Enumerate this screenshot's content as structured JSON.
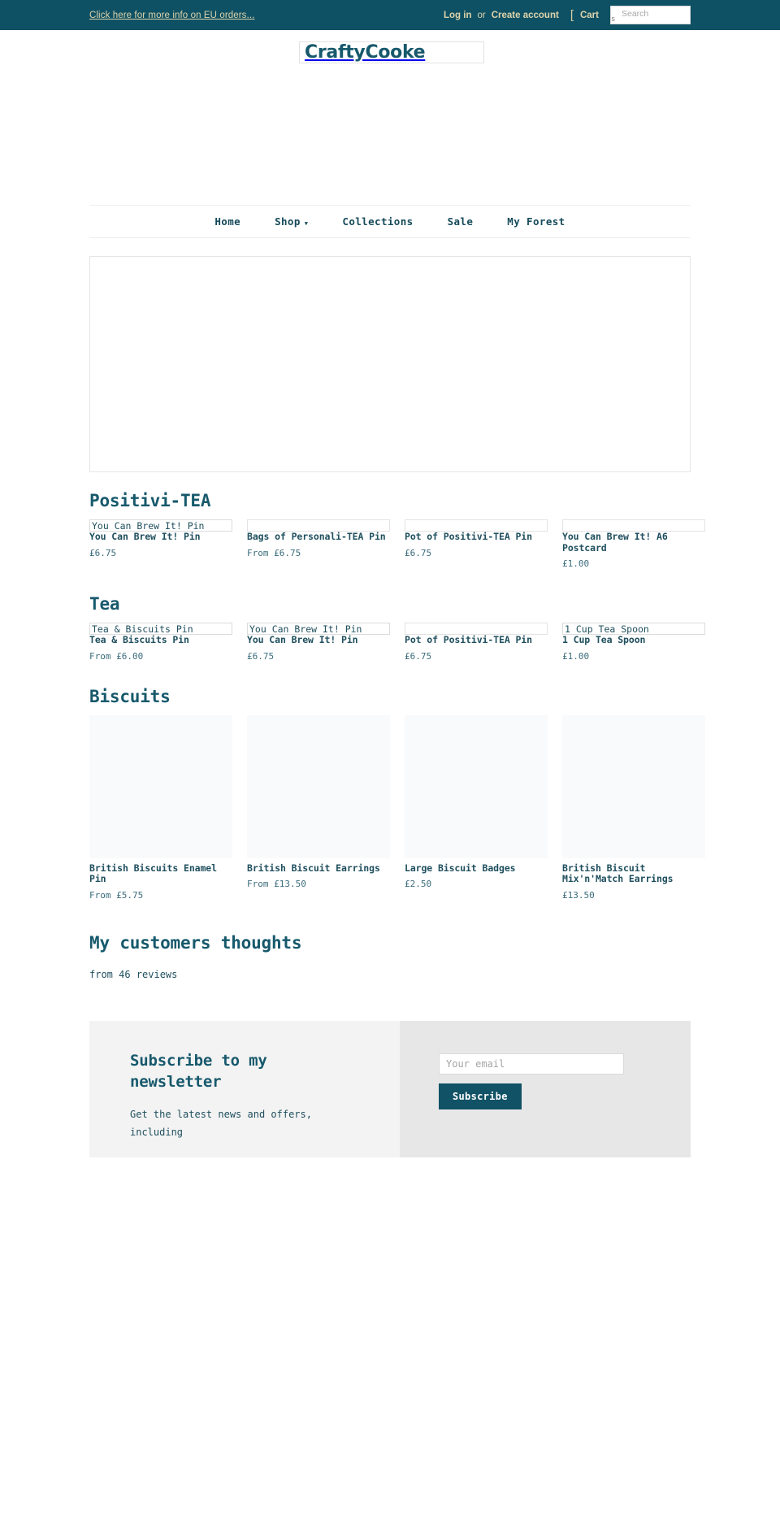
{
  "topbar": {
    "announcement": "Click here for more info on EU orders...",
    "login_label": "Log in",
    "or_label": "or",
    "create_account_label": "Create account",
    "cart_label": "Cart",
    "cart_bracket": "[",
    "search_placeholder": "Search",
    "search_value": "",
    "search_glyph": "s",
    "background_color": "#0f5164",
    "text_color": "#ddd3ab"
  },
  "brand": {
    "logo_text": "CraftyCooke",
    "logo_color": "#17596c"
  },
  "nav": {
    "items": [
      {
        "label": "Home",
        "has_caret": false
      },
      {
        "label": "Shop",
        "has_caret": true,
        "caret": "▼"
      },
      {
        "label": "Collections",
        "has_caret": false
      },
      {
        "label": "Sale",
        "has_caret": false
      },
      {
        "label": "My Forest",
        "has_caret": false
      }
    ]
  },
  "hero": {
    "alt": ""
  },
  "sections": [
    {
      "title": "Positivi-TEA",
      "products": [
        {
          "alt": "You Can Brew It! Pin",
          "title": "You Can Brew It! Pin",
          "price": "£6.75"
        },
        {
          "alt": "",
          "title": "Bags of Personali-TEA Pin",
          "price": "From £6.75"
        },
        {
          "alt": "",
          "title": "Pot of Positivi-TEA Pin",
          "price": "£6.75"
        },
        {
          "alt": "",
          "title": "You Can Brew It! A6 Postcard",
          "price": "£1.00"
        }
      ]
    },
    {
      "title": "Tea",
      "products": [
        {
          "alt": "Tea & Biscuits Pin",
          "title": "Tea & Biscuits Pin",
          "price": "From £6.00"
        },
        {
          "alt": "You Can Brew It! Pin",
          "title": "You Can Brew It! Pin",
          "price": "£6.75"
        },
        {
          "alt": "",
          "title": "Pot of Positivi-TEA Pin",
          "price": "£6.75"
        },
        {
          "alt": "1 Cup Tea Spoon",
          "title": "1 Cup Tea Spoon",
          "price": "£1.00"
        }
      ]
    },
    {
      "title": "Biscuits",
      "products": [
        {
          "alt": "",
          "title": "British Biscuits Enamel Pin",
          "price": "From £5.75"
        },
        {
          "alt": "",
          "title": "British Biscuit Earrings",
          "price": "From £13.50"
        },
        {
          "alt": "",
          "title": "Large Biscuit Badges",
          "price": "£2.50"
        },
        {
          "alt": "",
          "title": "British Biscuit Mix'n'Match Earrings",
          "price": "£13.50"
        }
      ]
    }
  ],
  "reviews": {
    "title": "My customers thoughts",
    "subtitle": "from 46 reviews"
  },
  "newsletter": {
    "title": "Subscribe to my newsletter",
    "body": "Get the latest news and offers, including",
    "email_placeholder": "Your email",
    "email_value": "",
    "subscribe_label": "Subscribe",
    "button_color": "#115266"
  }
}
